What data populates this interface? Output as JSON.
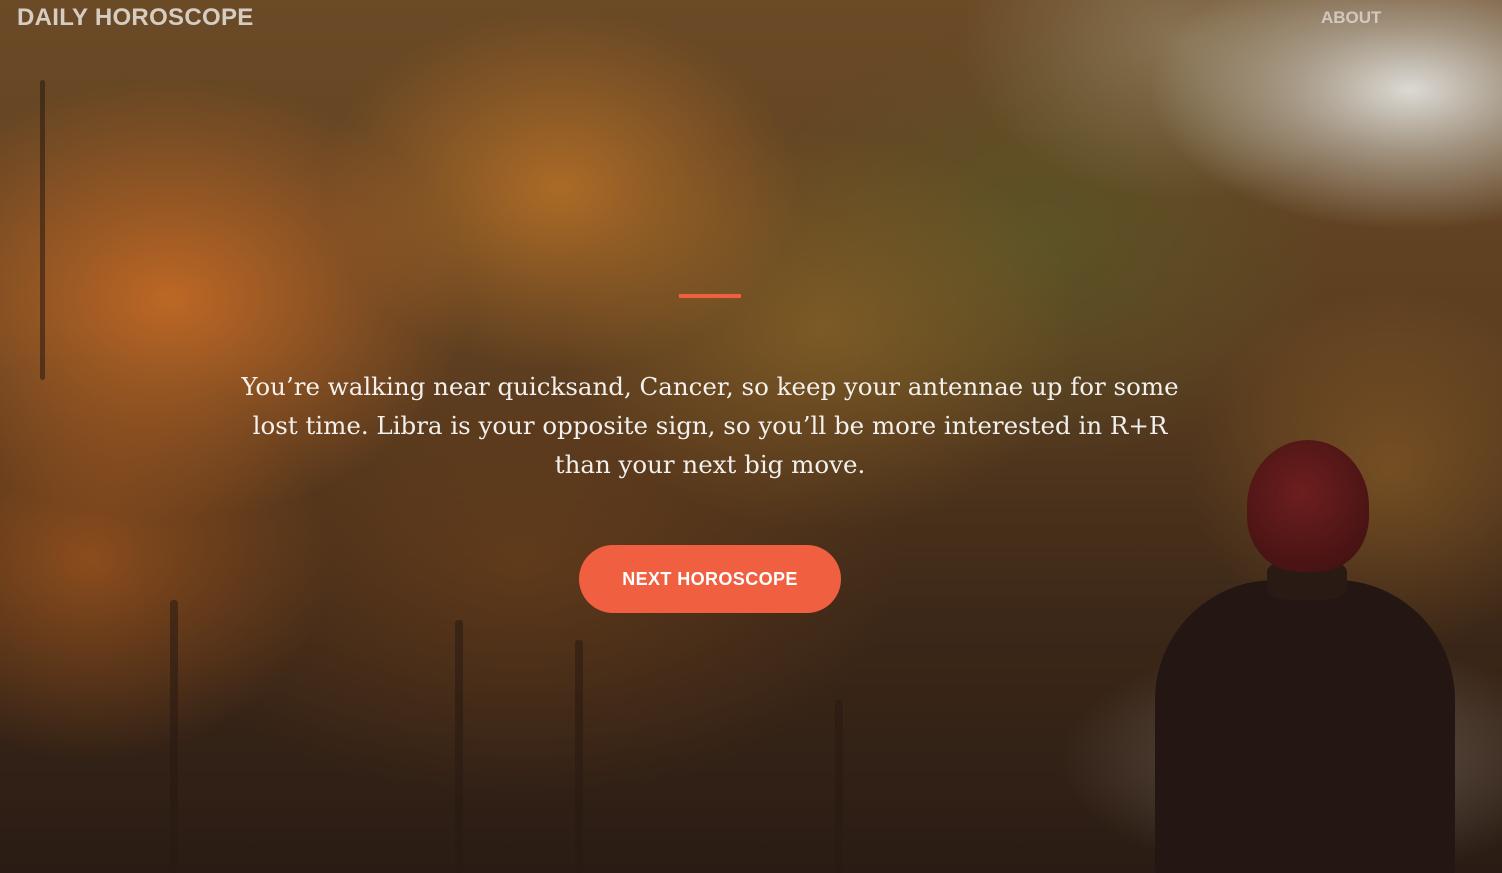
{
  "header": {
    "brand": "DAILY HOROSCOPE",
    "nav_about": "ABOUT"
  },
  "hero": {
    "horoscope_text": "You’re walking near quicksand, Cancer, so keep your antennae up for some lost time. Libra is your opposite sign, so you’ll be more interested in R+R than your next big move.",
    "next_button_label": "NEXT HOROSCOPE",
    "background_description_icon": "autumn-forest-photo"
  },
  "colors": {
    "accent": "#f05f40",
    "text": "#ffffff"
  }
}
